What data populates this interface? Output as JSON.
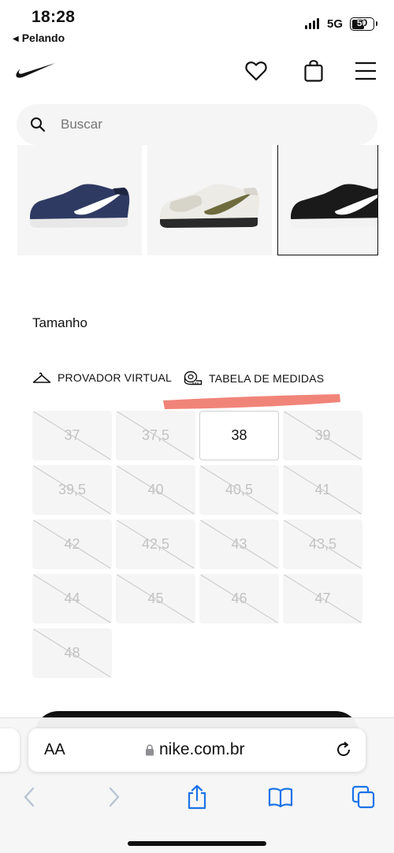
{
  "status": {
    "time": "18:28",
    "back_label": "Pelando",
    "network": "5G",
    "battery": "50"
  },
  "header": {
    "logo": "nike-swoosh",
    "icons": [
      "heart-icon",
      "bag-icon",
      "menu-icon"
    ]
  },
  "search": {
    "placeholder": "Buscar",
    "value": ""
  },
  "thumbnails": [
    {
      "colorway": "navy",
      "selected": false
    },
    {
      "colorway": "white-olive",
      "selected": false
    },
    {
      "colorway": "black",
      "selected": true
    }
  ],
  "size_section": {
    "title": "Tamanho",
    "virtual_fitting_label": "PROVADOR VIRTUAL",
    "size_chart_label": "TABELA DE MEDIDAS",
    "highlight_color": "#f07a6e",
    "sizes": [
      {
        "label": "37",
        "available": false
      },
      {
        "label": "37,5",
        "available": false
      },
      {
        "label": "38",
        "available": true
      },
      {
        "label": "39",
        "available": false
      },
      {
        "label": "39,5",
        "available": false
      },
      {
        "label": "40",
        "available": false
      },
      {
        "label": "40,5",
        "available": false
      },
      {
        "label": "41",
        "available": false
      },
      {
        "label": "42",
        "available": false
      },
      {
        "label": "42,5",
        "available": false
      },
      {
        "label": "43",
        "available": false
      },
      {
        "label": "43,5",
        "available": false
      },
      {
        "label": "44",
        "available": false
      },
      {
        "label": "45",
        "available": false
      },
      {
        "label": "46",
        "available": false
      },
      {
        "label": "47",
        "available": false
      },
      {
        "label": "48",
        "available": false
      }
    ]
  },
  "browser": {
    "aa_label": "AA",
    "url": "nike.com.br",
    "accent": "#1a73e8",
    "toolbar": [
      "back-icon",
      "forward-icon",
      "share-icon",
      "bookmarks-icon",
      "tabs-icon"
    ]
  }
}
